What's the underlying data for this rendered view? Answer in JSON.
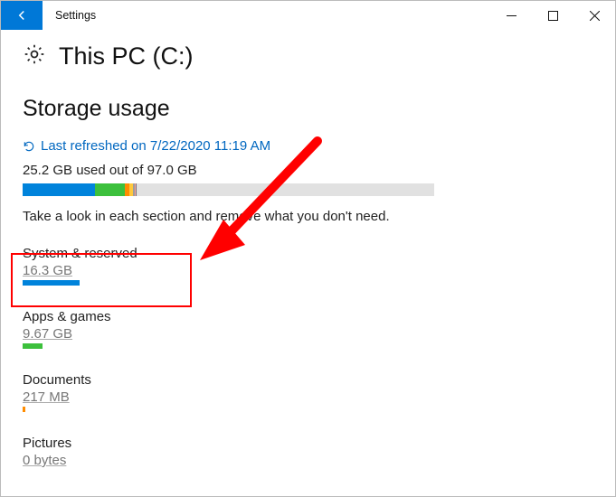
{
  "window": {
    "title": "Settings"
  },
  "page": {
    "title": "This PC (C:)"
  },
  "section": {
    "title": "Storage usage",
    "refresh_text": "Last refreshed on 7/22/2020 11:19 AM",
    "used_text": "25.2 GB used out of 97.0 GB",
    "hint": "Take a look in each section and remove what you don't need."
  },
  "categories": [
    {
      "label": "System & reserved",
      "size": "16.3 GB",
      "color": "#0083db",
      "percent": 100
    },
    {
      "label": "Apps & games",
      "size": "9.67 GB",
      "color": "#3cc03c",
      "percent": 35
    },
    {
      "label": "Documents",
      "size": "217 MB",
      "color": "#ff8c00",
      "percent": 5
    },
    {
      "label": "Pictures",
      "size": "0 bytes",
      "color": "#ffc83d",
      "percent": 0
    }
  ]
}
